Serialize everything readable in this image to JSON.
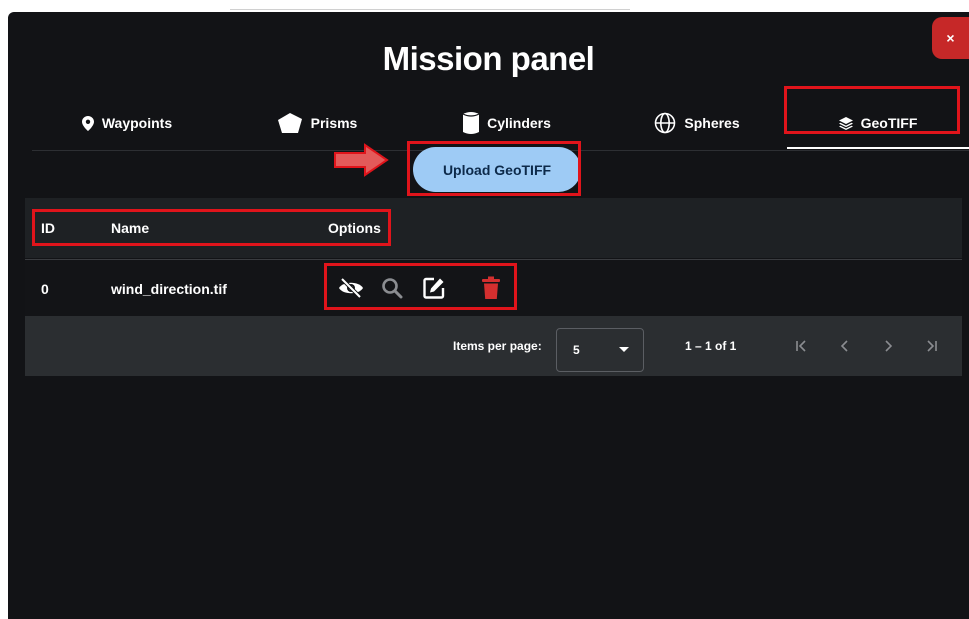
{
  "panel": {
    "title": "Mission panel",
    "close_label": "×"
  },
  "tabs": [
    {
      "label": "Waypoints",
      "icon": "map-pin-icon"
    },
    {
      "label": "Prisms",
      "icon": "pentagon-icon"
    },
    {
      "label": "Cylinders",
      "icon": "cylinder-icon"
    },
    {
      "label": "Spheres",
      "icon": "globe-icon"
    },
    {
      "label": "GeoTIFF",
      "icon": "layers-icon",
      "active": true
    }
  ],
  "upload": {
    "label": "Upload GeoTIFF"
  },
  "table": {
    "columns": [
      "ID",
      "Name",
      "Options"
    ],
    "rows": [
      {
        "id": "0",
        "name": "wind_direction.tif",
        "options": [
          "eye-slash-icon",
          "search-icon",
          "edit-icon",
          "trash-icon"
        ]
      }
    ]
  },
  "paginator": {
    "items_per_page_label": "Items per page:",
    "page_size": "5",
    "range_label": "1 – 1 of 1"
  },
  "colors": {
    "panel_bg": "#121316",
    "upload_bg": "#9ecbf5",
    "highlight": "#e0141b",
    "delete": "#d32f2f",
    "close_bg": "#c62828"
  }
}
